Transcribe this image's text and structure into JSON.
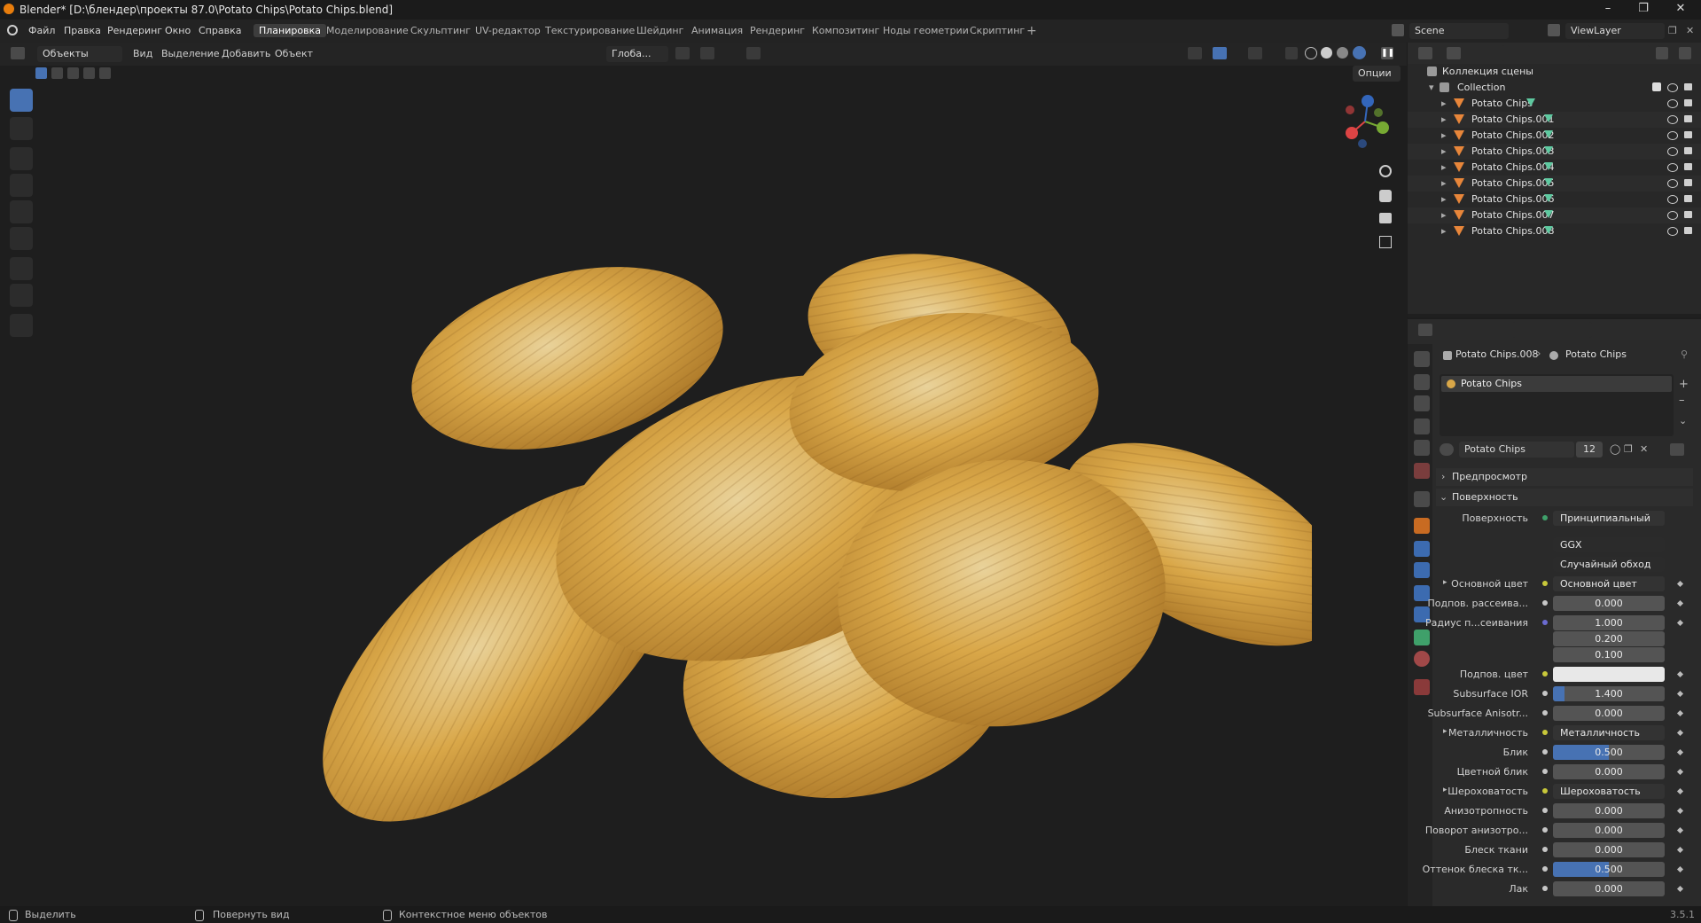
{
  "title": "Blender* [D:\\блендер\\проекты 87.0\\Potato Chips\\Potato Chips.blend]",
  "menu": [
    "Файл",
    "Правка",
    "Рендеринг",
    "Окно",
    "Справка"
  ],
  "workspaces": [
    "Планировка",
    "Моделирование",
    "Скульптинг",
    "UV-редактор",
    "Текстурирование",
    "Шейдинг",
    "Анимация",
    "Рендеринг",
    "Композитинг",
    "Ноды геометрии",
    "Скриптинг"
  ],
  "scene": "Scene",
  "viewlayer": "ViewLayer",
  "vp_header": {
    "mode": "Объекты",
    "view": "Вид",
    "select": "Выделение",
    "add": "Добавить",
    "object": "Объект",
    "orientation": "Глоба...",
    "options": "Опции"
  },
  "outliner": {
    "scene_collection": "Коллекция сцены",
    "collection": "Collection",
    "items": [
      "Potato Chips",
      "Potato Chips.001",
      "Potato Chips.002",
      "Potato Chips.003",
      "Potato Chips.004",
      "Potato Chips.005",
      "Potato Chips.006",
      "Potato Chips.007",
      "Potato Chips.008"
    ]
  },
  "properties": {
    "breadcrumb_obj": "Potato Chips.008",
    "breadcrumb_mat": "Potato Chips",
    "slot": "Potato Chips",
    "material_name": "Potato Chips",
    "users": "12",
    "preview": "Предпросмотр",
    "surface_section": "Поверхность",
    "surface_label": "Поверхность",
    "surface_value": "Принципиальный BSDF",
    "distribution": "GGX",
    "subsurface_method": "Случайный обход",
    "rows": [
      {
        "label": "Основной цвет",
        "value": "Основной цвет",
        "kind": "link"
      },
      {
        "label": "Подпов. рассеива...",
        "value": "0.000",
        "kind": "num"
      },
      {
        "label": "Радиус п...сеивания",
        "value": "1.000",
        "kind": "num"
      },
      {
        "label": "",
        "value": "0.200",
        "kind": "num"
      },
      {
        "label": "",
        "value": "0.100",
        "kind": "num"
      },
      {
        "label": "Подпов. цвет",
        "value": "",
        "kind": "color"
      },
      {
        "label": "Subsurface IOR",
        "value": "1.400",
        "kind": "num",
        "fill": 0.1
      },
      {
        "label": "Subsurface Anisotr...",
        "value": "0.000",
        "kind": "num"
      },
      {
        "label": "Металличность",
        "value": "Металличность",
        "kind": "link"
      },
      {
        "label": "Блик",
        "value": "0.500",
        "kind": "num",
        "fill": 0.5
      },
      {
        "label": "Цветной блик",
        "value": "0.000",
        "kind": "num"
      },
      {
        "label": "Шероховатость",
        "value": "Шероховатость",
        "kind": "link"
      },
      {
        "label": "Анизотропность",
        "value": "0.000",
        "kind": "num"
      },
      {
        "label": "Поворот анизотро...",
        "value": "0.000",
        "kind": "num"
      },
      {
        "label": "Блеск ткани",
        "value": "0.000",
        "kind": "num"
      },
      {
        "label": "Оттенок блеска тк...",
        "value": "0.500",
        "kind": "num",
        "fill": 0.5
      },
      {
        "label": "Лак",
        "value": "0.000",
        "kind": "num"
      }
    ]
  },
  "status": {
    "select": "Выделить",
    "rotate": "Повернуть вид",
    "context": "Контекстное меню объектов",
    "version": "3.5.1"
  },
  "colors": {
    "accent": "#4772b3",
    "mesh": "#e8863a",
    "data": "#5ec9a0"
  }
}
